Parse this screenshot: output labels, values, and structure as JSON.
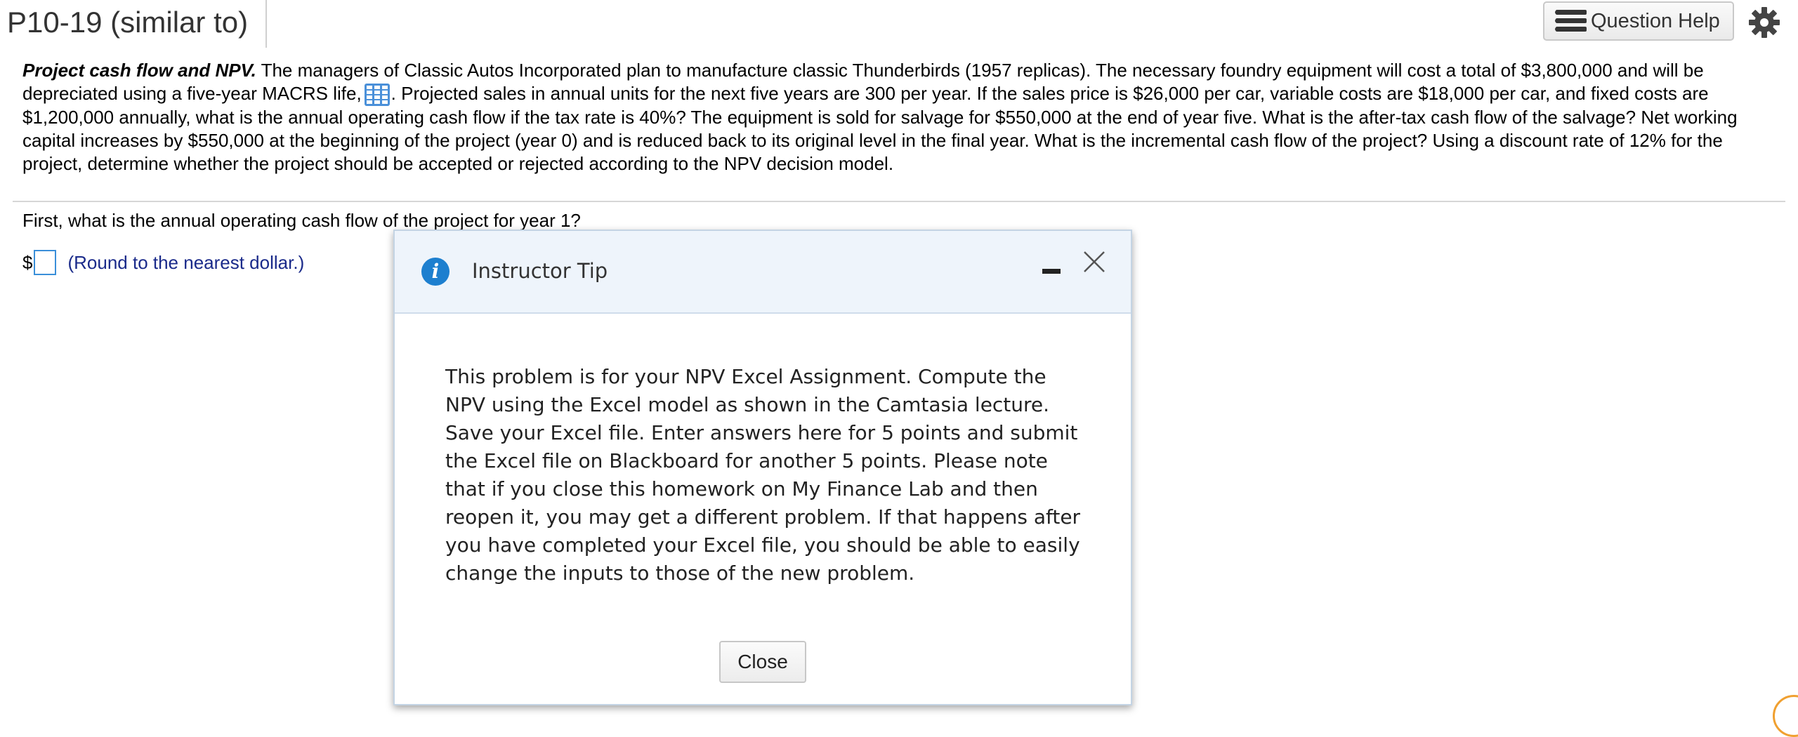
{
  "header": {
    "title": "P10-19 (similar to)",
    "help_label": "Question Help",
    "help_icon": "list-icon",
    "settings_icon": "gear-icon"
  },
  "problem": {
    "lead": "Project cash flow and NPV.",
    "text_part1": " The managers of Classic Autos Incorporated plan to manufacture classic Thunderbirds (1957 replicas). The necessary foundry equipment will cost a total of $3,800,000 and will be depreciated using a five-year MACRS life,",
    "text_part2": ". Projected sales in annual units for the next five years are 300 per year. If the sales price is $26,000 per car, variable costs are $18,000 per car, and fixed costs are $1,200,000 annually, what is the annual operating cash flow if the tax rate is 40%? The equipment is sold for salvage for $550,000 at the end of year five. What is the after-tax cash flow of the salvage? Net working capital increases by $550,000 at the beginning of the project (year 0) and is reduced back to its original level in the final year. What is the incremental cash flow of the project? Using a discount rate of 12% for the project, determine whether the project should be accepted or rejected according to the NPV decision model."
  },
  "question": {
    "text": "First, what is the annual operating cash flow of the project for year 1?",
    "currency": "$",
    "hint": "(Round to the nearest dollar.)",
    "answer_value": ""
  },
  "modal": {
    "title": "Instructor Tip",
    "body": "This problem is for your NPV Excel Assignment. Compute the NPV using the Excel model as shown in the Camtasia lecture. Save your Excel file. Enter answers here for 5 points and submit the Excel file on Blackboard for another 5 points. Please note that if you close this homework on My Finance Lab and then reopen it, you may get a different problem. If that happens after you have completed your Excel file, you should be able to easily change the inputs to those of the new problem.",
    "close_label": "Close",
    "info_glyph": "i"
  },
  "colors": {
    "accent": "#1d7fcf",
    "modal_header_bg": "#eef4fb",
    "hint_text": "#1a2a8a"
  }
}
